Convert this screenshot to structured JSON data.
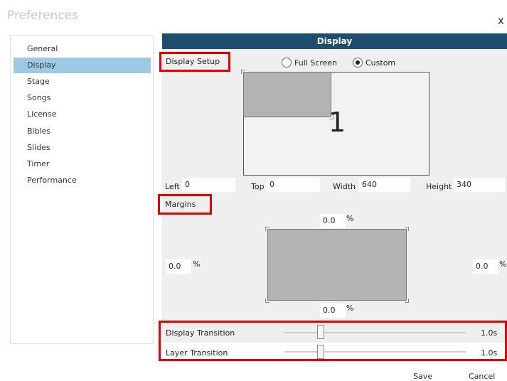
{
  "window": {
    "title": "Preferences",
    "close_glyph": "x"
  },
  "sidebar": {
    "items": [
      {
        "label": "General"
      },
      {
        "label": "Display",
        "active": true
      },
      {
        "label": "Stage"
      },
      {
        "label": "Songs"
      },
      {
        "label": "License"
      },
      {
        "label": "Bibles"
      },
      {
        "label": "Slides"
      },
      {
        "label": "Timer"
      },
      {
        "label": "Performance"
      }
    ]
  },
  "panel": {
    "header": "Display"
  },
  "display_setup": {
    "label": "Display Setup",
    "mode_options": [
      {
        "label": "Full Screen",
        "selected": false
      },
      {
        "label": "Custom",
        "selected": true
      }
    ],
    "monitor_number": "1",
    "left_label": "Left",
    "left_value": "0",
    "top_label": "Top",
    "top_value": "0",
    "width_label": "Width",
    "width_value": "640",
    "height_label": "Height",
    "height_value": "340"
  },
  "margins": {
    "label": "Margins",
    "top": "0.0",
    "left": "0.0",
    "right": "0.0",
    "bottom": "0.0",
    "unit": "%"
  },
  "transitions": {
    "display_label": "Display Transition",
    "display_value": "1.0s",
    "layer_label": "Layer Transition",
    "layer_value": "1.0s"
  },
  "footer": {
    "save_label": "Save",
    "cancel_label": "Cancel"
  },
  "colors": {
    "header_bg": "#1f4d6d",
    "selected_bg": "#9ec9e4",
    "highlight": "#e60000",
    "panel_bg": "#efefef"
  }
}
